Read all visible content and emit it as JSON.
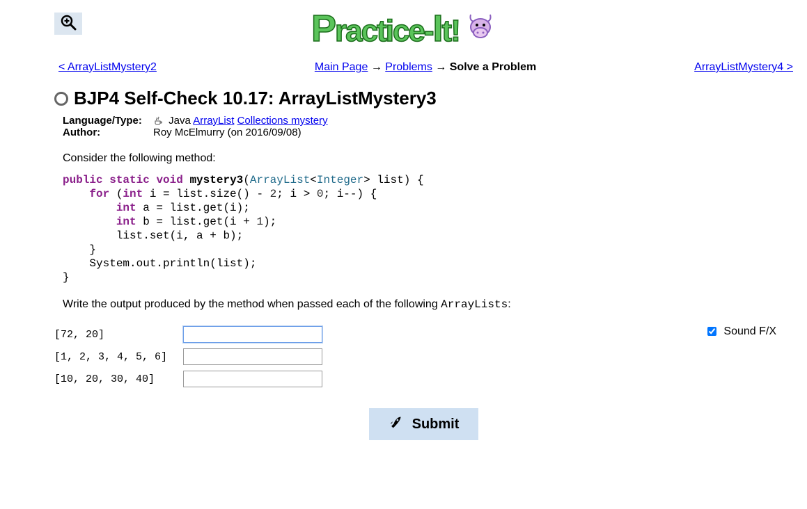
{
  "nav": {
    "prev": "< ArrayListMystery2",
    "main_page": "Main Page",
    "problems": "Problems",
    "solve": "Solve a Problem",
    "next": "ArrayListMystery4 >"
  },
  "logo": "Practice-It!",
  "title": "BJP4 Self-Check 10.17: ArrayListMystery3",
  "meta": {
    "lang_label": "Language/Type:",
    "lang_val_plain": "Java",
    "lang_link1": "ArrayList",
    "lang_link2": "Collections mystery",
    "author_label": "Author:",
    "author_val": "Roy McElmurry (on 2016/09/08)"
  },
  "prompt1": "Consider the following method:",
  "code_tokens": [
    [
      "kw",
      "public"
    ],
    [
      "sp",
      " "
    ],
    [
      "kw",
      "static"
    ],
    [
      "sp",
      " "
    ],
    [
      "kw",
      "void"
    ],
    [
      "sp",
      " "
    ],
    [
      "fn",
      "mystery3"
    ],
    [
      "pl",
      "("
    ],
    [
      "type",
      "ArrayList"
    ],
    [
      "pl",
      "<"
    ],
    [
      "type",
      "Integer"
    ],
    [
      "pl",
      "> list) {"
    ],
    [
      "nl"
    ],
    [
      "sp",
      "    "
    ],
    [
      "kw",
      "for"
    ],
    [
      "pl",
      " ("
    ],
    [
      "kw",
      "int"
    ],
    [
      "pl",
      " i = list.size() - "
    ],
    [
      "num",
      "2"
    ],
    [
      "pl",
      "; i > "
    ],
    [
      "num",
      "0"
    ],
    [
      "pl",
      "; i--) {"
    ],
    [
      "nl"
    ],
    [
      "sp",
      "        "
    ],
    [
      "kw",
      "int"
    ],
    [
      "pl",
      " a = list.get(i);"
    ],
    [
      "nl"
    ],
    [
      "sp",
      "        "
    ],
    [
      "kw",
      "int"
    ],
    [
      "pl",
      " b = list.get(i + "
    ],
    [
      "num",
      "1"
    ],
    [
      "pl",
      ");"
    ],
    [
      "nl"
    ],
    [
      "sp",
      "        "
    ],
    [
      "pl",
      "list.set(i, a + b);"
    ],
    [
      "nl"
    ],
    [
      "sp",
      "    "
    ],
    [
      "pl",
      "}"
    ],
    [
      "nl"
    ],
    [
      "sp",
      "    "
    ],
    [
      "pl",
      "System.out.println(list);"
    ],
    [
      "nl"
    ],
    [
      "pl",
      "}"
    ]
  ],
  "prompt2_pre": "Write the output produced by the method when passed each of the following ",
  "prompt2_code": "ArrayLists",
  "prompt2_post": ":",
  "inputs": [
    {
      "label": "[72, 20]",
      "value": ""
    },
    {
      "label": "[1, 2, 3, 4, 5, 6]",
      "value": ""
    },
    {
      "label": "[10, 20, 30, 40]",
      "value": ""
    }
  ],
  "soundfx_label": "Sound F/X",
  "submit_label": "Submit"
}
